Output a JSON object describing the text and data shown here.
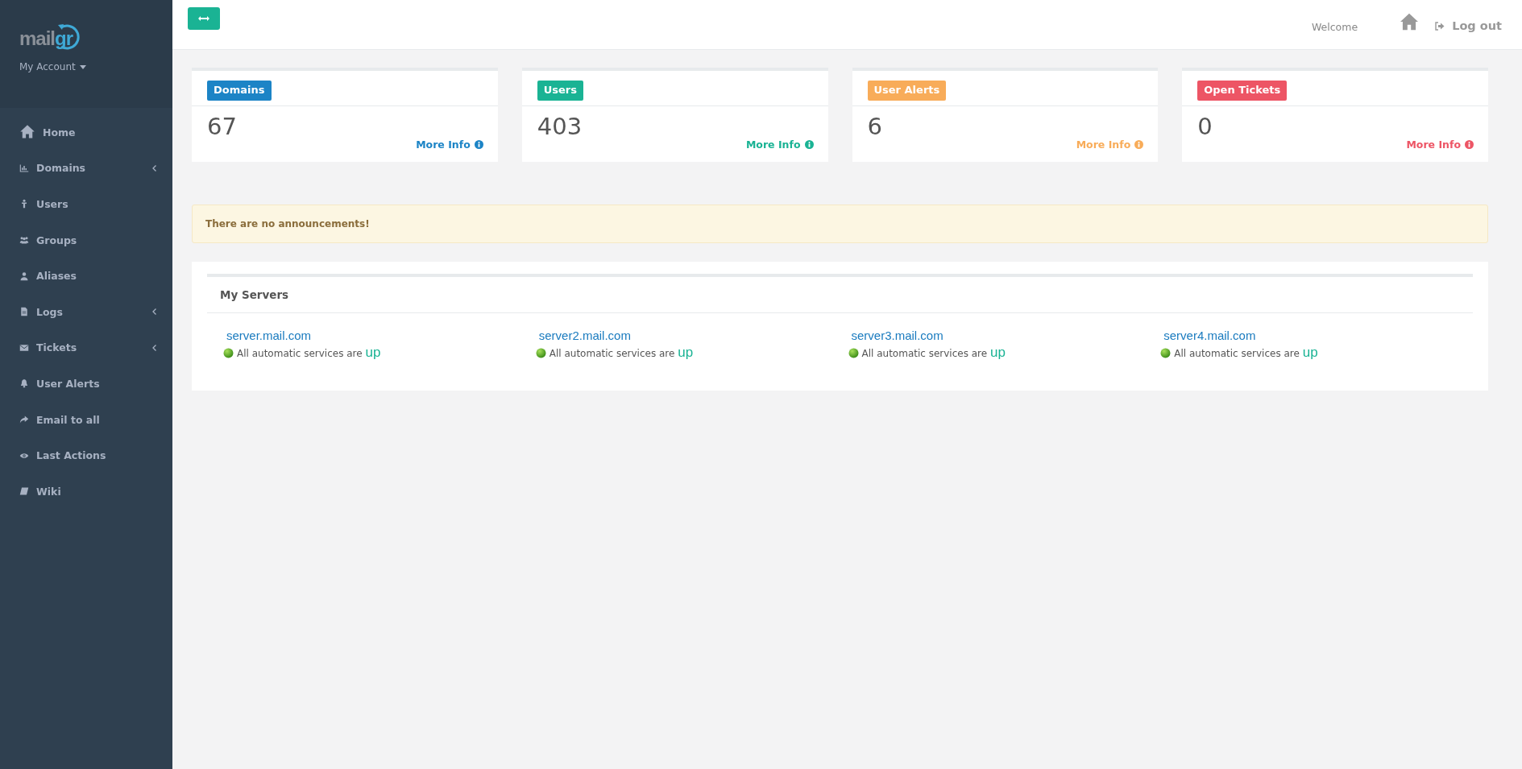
{
  "sidebar": {
    "logo": {
      "part_1": "mail",
      "part_2": "gr"
    },
    "account": "My Account",
    "items": [
      {
        "label": "Home",
        "submenu": false
      },
      {
        "label": "Domains",
        "submenu": true
      },
      {
        "label": "Users",
        "submenu": false
      },
      {
        "label": "Groups",
        "submenu": false
      },
      {
        "label": "Aliases",
        "submenu": false
      },
      {
        "label": "Logs",
        "submenu": true
      },
      {
        "label": "Tickets",
        "submenu": true
      },
      {
        "label": "User Alerts",
        "submenu": false
      },
      {
        "label": "Email to all",
        "submenu": false
      },
      {
        "label": "Last Actions",
        "submenu": false
      },
      {
        "label": "Wiki",
        "submenu": false
      }
    ]
  },
  "topbar": {
    "welcome": "Welcome",
    "logout": "Log out"
  },
  "stats": [
    {
      "label": "Domains",
      "value": "67",
      "link": "More Info",
      "color": "#1c84c6"
    },
    {
      "label": "Users",
      "value": "403",
      "link": "More Info",
      "color": "#1ab394"
    },
    {
      "label": "User Alerts",
      "value": "6",
      "link": "More Info",
      "color": "#f8ac59"
    },
    {
      "label": "Open Tickets",
      "value": "0",
      "link": "More Info",
      "color": "#ed5565"
    }
  ],
  "announcement": "There are no announcements!",
  "servers": {
    "title": "My Servers",
    "items": [
      {
        "name": "server.mail.com",
        "status_text": "All automatic services are",
        "status_word": "up"
      },
      {
        "name": "server2.mail.com",
        "status_text": "All automatic services are",
        "status_word": "up"
      },
      {
        "name": "server3.mail.com",
        "status_text": "All automatic services are",
        "status_word": "up"
      },
      {
        "name": "server4.mail.com",
        "status_text": "All automatic services are",
        "status_word": "up"
      }
    ]
  }
}
